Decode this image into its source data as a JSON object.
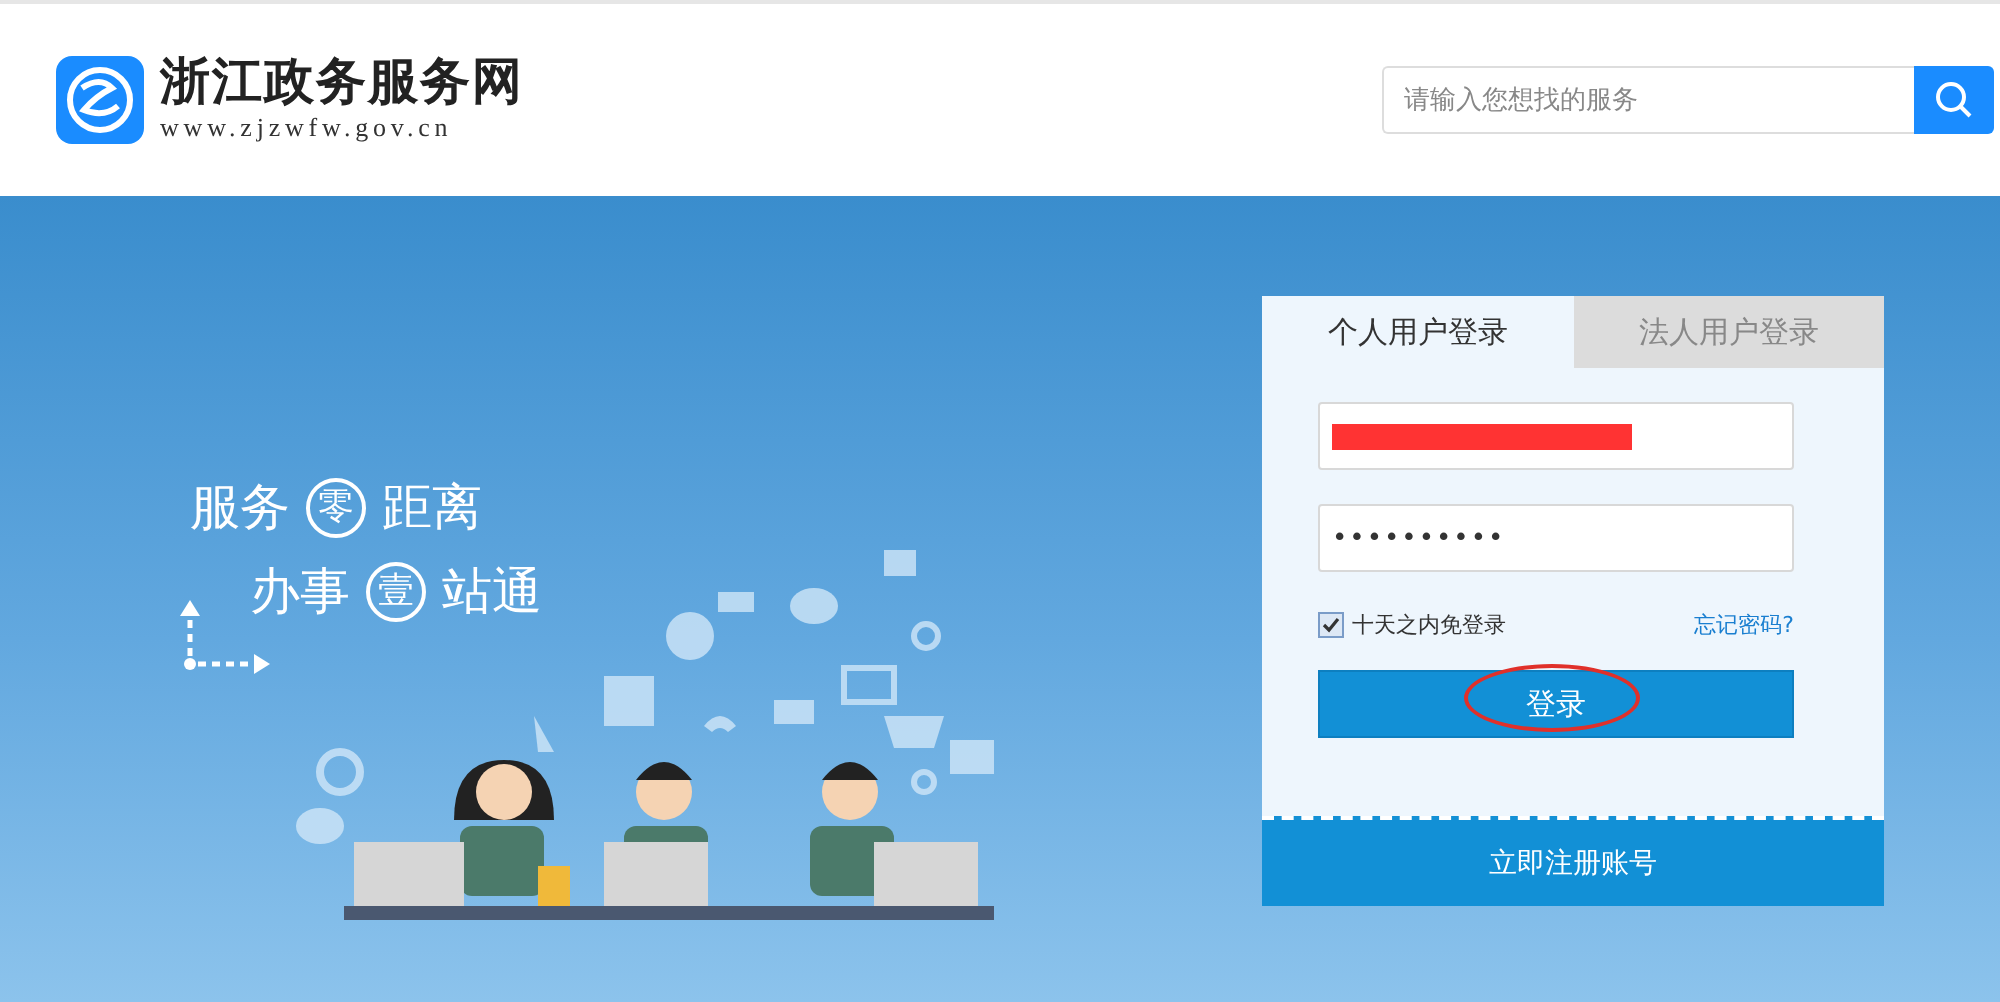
{
  "header": {
    "site_name": "浙江政务服务网",
    "site_url": "www.zjzwfw.gov.cn",
    "search": {
      "placeholder": "请输入您想找的服务"
    }
  },
  "slogan": [
    {
      "before": "服务",
      "circled": "零",
      "after": "距离"
    },
    {
      "before": "办事",
      "circled": "壹",
      "after": "站通"
    }
  ],
  "login": {
    "tabs": [
      {
        "label": "个人用户登录",
        "selected": true
      },
      {
        "label": "法人用户登录",
        "selected": false
      }
    ],
    "password": {
      "value": "••••••••••"
    },
    "remember": {
      "label": "十天之内免登录",
      "checked": true
    },
    "forgot_link": "忘记密码?",
    "submit": "登录",
    "register_link": "立即注册账号"
  }
}
